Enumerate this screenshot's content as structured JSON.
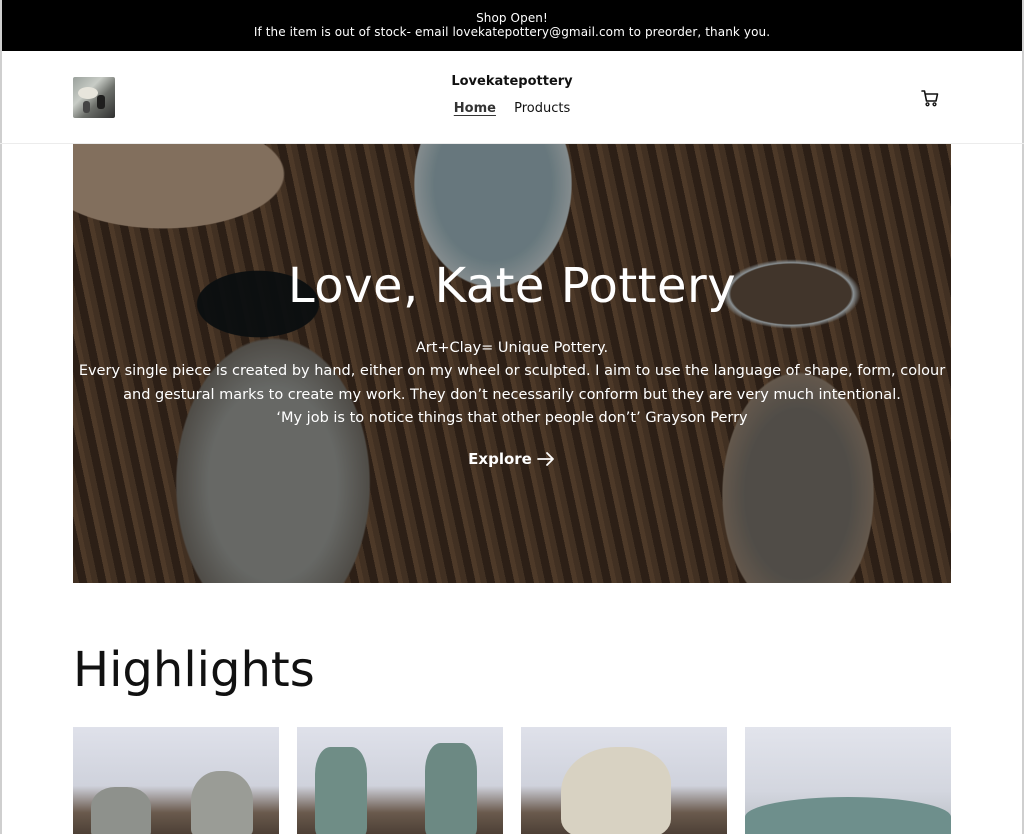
{
  "announcement": {
    "line1": "Shop Open!",
    "line2": "If the item is out of stock- email lovekatepottery@gmail.com to preorder, thank you."
  },
  "header": {
    "brand": "Lovekatepottery",
    "nav": [
      {
        "label": "Home",
        "active": true
      },
      {
        "label": "Products",
        "active": false
      }
    ],
    "cart_icon": "cart-icon"
  },
  "hero": {
    "title": "Love, Kate Pottery",
    "lines": [
      "Art+Clay= Unique Pottery.",
      "Every single piece is created by hand, either on my wheel or sculpted. I aim to use the language of shape, form, colour",
      "and gestural marks to create my work. They don’t necessarily conform but they are very much intentional.",
      "‘My job is to notice things that other people don’t’ Grayson Perry"
    ],
    "cta_label": "Explore"
  },
  "highlights": {
    "title": "Highlights",
    "cards": [
      {
        "name": "highlight-card-1"
      },
      {
        "name": "highlight-card-2"
      },
      {
        "name": "highlight-card-3"
      },
      {
        "name": "highlight-card-4"
      }
    ]
  },
  "colors": {
    "announcement_bg": "#000000",
    "text": "#111111",
    "hero_text": "#ffffff"
  }
}
